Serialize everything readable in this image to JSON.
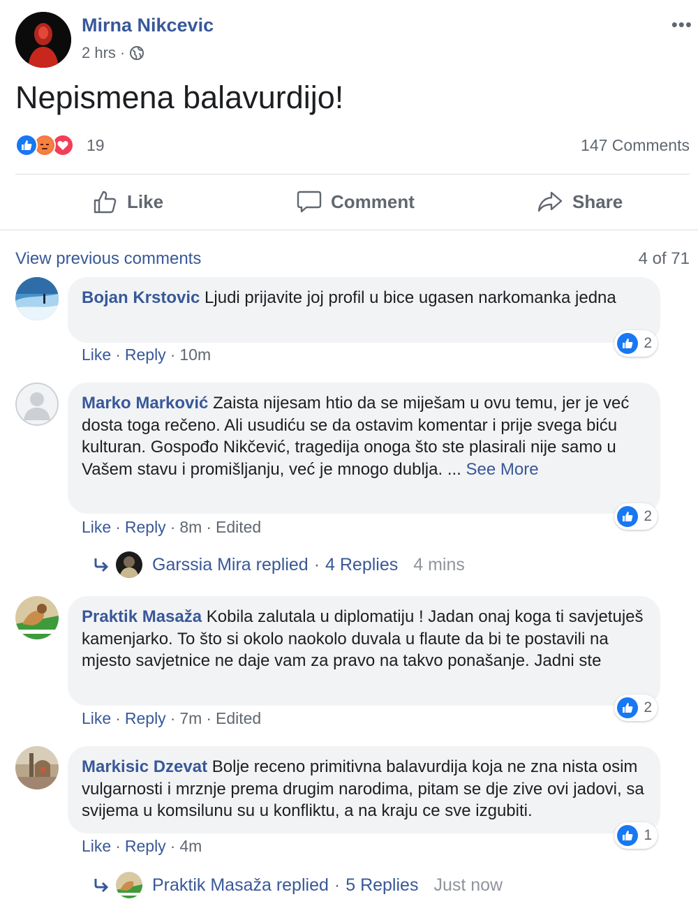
{
  "post": {
    "author": "Mirna Nikcevic",
    "time": "2 hrs",
    "separator": "·",
    "more_label": "•••",
    "text": "Nepismena balavurdijo!",
    "reaction_count": "19",
    "reaction_types": [
      "like-icon",
      "angry-icon",
      "love-icon"
    ],
    "comments_count": "147 Comments"
  },
  "actions": {
    "like": "Like",
    "comment": "Comment",
    "share": "Share"
  },
  "comments_section": {
    "view_previous": "View previous comments",
    "count": "4 of 71"
  },
  "comments": [
    {
      "author": "Bojan Krstovic",
      "text": "Ljudi prijavite joj profil u bice ugasen narkomanka jedna",
      "like_count": "2",
      "like": "Like",
      "reply": "Reply",
      "time": "10m",
      "edited": ""
    },
    {
      "author": "Marko Marković",
      "text": "Zaista nijesam htio da se miješam u ovu temu, jer je već dosta toga rečeno. Ali usudiću se da ostavim komentar i prije svega biću kulturan. Gospođo Nikčević, tragedija onoga što ste plasirali nije samo u Vašem stavu i promišljanju, već je mnogo dublja.",
      "ellipsis": "...",
      "see_more": "See More",
      "like_count": "2",
      "like": "Like",
      "reply": "Reply",
      "time": "8m",
      "edited": "Edited",
      "replies": {
        "replier": "Garssia Mira replied",
        "count": "4 Replies",
        "time": "4 mins"
      }
    },
    {
      "author": "Praktik Masaža",
      "text": "Kobila zalutala u diplomatiju ! Jadan onaj koga ti savjetuješ kamenjarko. To što si okolo naokolo duvala u flaute da bi te postavili na mjesto savjetnice ne daje vam za pravo na takvo ponašanje. Jadni ste",
      "like_count": "2",
      "like": "Like",
      "reply": "Reply",
      "time": "7m",
      "edited": "Edited"
    },
    {
      "author": "Markisic Dzevat",
      "text": "Bolje receno primitivna balavurdija koja ne zna nista osim vulgarnosti i mrznje prema drugim narodima, pitam se dje zive ovi jadovi, sa svijema u komsilunu su u konfliktu, a na kraju ce sve izgubiti.",
      "like_count": "1",
      "like": "Like",
      "reply": "Reply",
      "time": "4m",
      "edited": "",
      "replies": {
        "replier": "Praktik Masaža replied",
        "count": "5 Replies",
        "time": "Just now"
      }
    }
  ],
  "colors": {
    "link": "#385898",
    "muted": "#606770",
    "bubble": "#f2f3f5",
    "like_blue": "#1877f2",
    "angry": "#f7714c",
    "love": "#f33e58"
  }
}
